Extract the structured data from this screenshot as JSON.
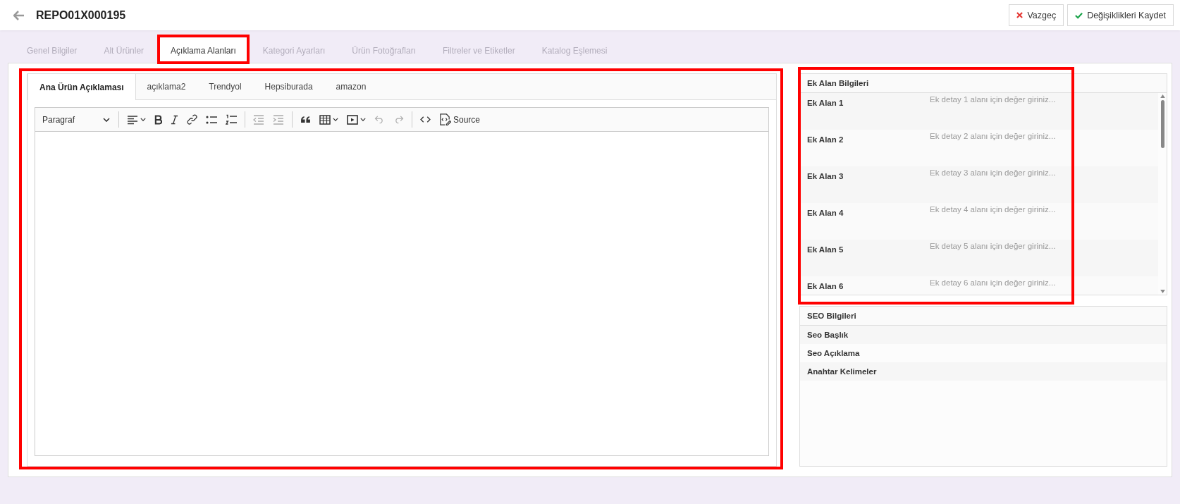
{
  "header": {
    "title": "REPO01X000195",
    "buttons": [
      {
        "label": "Vazgeç",
        "kind": "cancel"
      },
      {
        "label": "Değişiklikleri Kaydet",
        "kind": "save"
      }
    ]
  },
  "tabs": [
    {
      "label": "Genel Bilgiler",
      "selected": false
    },
    {
      "label": "Alt Ürünler",
      "selected": false
    },
    {
      "label": "Açıklama Alanları",
      "selected": true
    },
    {
      "label": "Kategori Ayarları",
      "selected": false
    },
    {
      "label": "Ürün Fotoğrafları",
      "selected": false
    },
    {
      "label": "Filtreler ve Etiketler",
      "selected": false
    },
    {
      "label": "Katalog Eşlemesi",
      "selected": false
    }
  ],
  "description": {
    "tabs": [
      {
        "label": "Ana Ürün Açıklaması",
        "selected": true
      },
      {
        "label": "açıklama2",
        "selected": false
      },
      {
        "label": "Trendyol",
        "selected": false
      },
      {
        "label": "Hepsiburada",
        "selected": false
      },
      {
        "label": "amazon",
        "selected": false
      }
    ],
    "toolbar": {
      "format": "Paragraf",
      "items": [
        {
          "kind": "separator"
        },
        {
          "kind": "align",
          "disabled": false
        },
        {
          "kind": "bold",
          "disabled": false
        },
        {
          "kind": "italic",
          "disabled": false
        },
        {
          "kind": "link",
          "disabled": false
        },
        {
          "kind": "bulleted-list",
          "disabled": false
        },
        {
          "kind": "numbered-list",
          "disabled": false
        },
        {
          "kind": "separator"
        },
        {
          "kind": "outdent",
          "disabled": true
        },
        {
          "kind": "indent",
          "disabled": true
        },
        {
          "kind": "separator"
        },
        {
          "kind": "quote",
          "disabled": false
        },
        {
          "kind": "table",
          "disabled": false
        },
        {
          "kind": "media",
          "disabled": false
        },
        {
          "kind": "undo",
          "disabled": true
        },
        {
          "kind": "redo",
          "disabled": true
        },
        {
          "kind": "separator"
        },
        {
          "kind": "code",
          "disabled": false
        },
        {
          "kind": "source",
          "label": "Source",
          "disabled": false
        }
      ]
    }
  },
  "extra_fields": {
    "title": "Ek Alan Bilgileri",
    "rows": [
      {
        "label": "Ek Alan 1",
        "placeholder": "Ek detay 1 alanı için değer giriniz..."
      },
      {
        "label": "Ek Alan 2",
        "placeholder": "Ek detay 2 alanı için değer giriniz..."
      },
      {
        "label": "Ek Alan 3",
        "placeholder": "Ek detay 3 alanı için değer giriniz..."
      },
      {
        "label": "Ek Alan 4",
        "placeholder": "Ek detay 4 alanı için değer giriniz..."
      },
      {
        "label": "Ek Alan 5",
        "placeholder": "Ek detay 5 alanı için değer giriniz..."
      },
      {
        "label": "Ek Alan 6",
        "placeholder": "Ek detay 6 alanı için değer giriniz..."
      }
    ]
  },
  "seo": {
    "title": "SEO Bilgileri",
    "rows": [
      "Seo Başlık",
      "Seo Açıklama",
      "Anahtar Kelimeler"
    ]
  }
}
